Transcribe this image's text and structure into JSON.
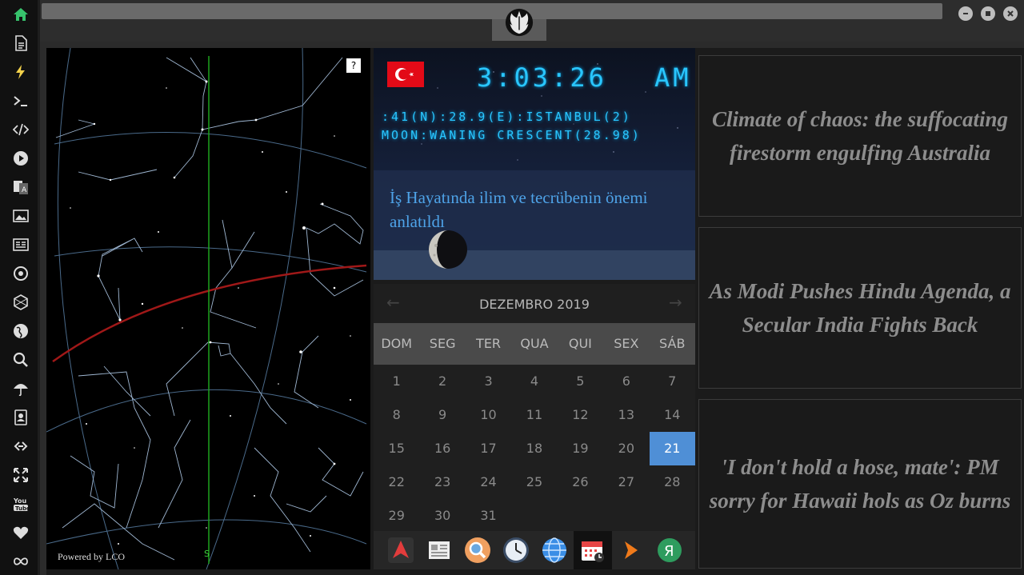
{
  "sidebar": {
    "icons": [
      "home-icon",
      "file-icon",
      "bolt-icon",
      "terminal-icon",
      "code-icon",
      "play-icon",
      "translate-icon",
      "image-icon",
      "news-icon",
      "rebel-icon",
      "hexagon-icon",
      "globe-icon",
      "search-icon",
      "umbrella-icon",
      "contacts-icon",
      "link-icon",
      "expand-icon",
      "youtube-icon",
      "heart-icon",
      "infinity-icon"
    ],
    "accent": "#37c26c"
  },
  "skymap": {
    "credit": "Powered by LCO",
    "help": "?",
    "south_marker": "S"
  },
  "clock": {
    "time": "3:03:26",
    "ampm": "AM",
    "location": ":41(N):28.9(E):ISTANBUL(2)",
    "moon": "MOON:WANING CRESCENT(28.98)",
    "headline": "İş Hayatında ilim ve tecrübenin önemi anlatıldı",
    "flag": "turkey-flag",
    "lcd_color": "#29c6ff"
  },
  "calendar": {
    "prev": "←",
    "next": "→",
    "month": "DEZEMBRO 2019",
    "dow": [
      "DOM",
      "SEG",
      "TER",
      "QUA",
      "QUI",
      "SEX",
      "SÁB"
    ],
    "weeks": [
      [
        "1",
        "2",
        "3",
        "4",
        "5",
        "6",
        "7"
      ],
      [
        "8",
        "9",
        "10",
        "11",
        "12",
        "13",
        "14"
      ],
      [
        "15",
        "16",
        "17",
        "18",
        "19",
        "20",
        "21"
      ],
      [
        "22",
        "23",
        "24",
        "25",
        "26",
        "27",
        "28"
      ],
      [
        "29",
        "30",
        "31",
        "",
        "",
        "",
        ""
      ]
    ],
    "today": "21",
    "highlight_color": "#4f8fd6"
  },
  "dock": {
    "apps": [
      "arch-icon",
      "newspaper-icon",
      "magnifier-icon",
      "clock-icon",
      "globe-icon",
      "calendar-icon",
      "arrow-icon",
      "yandex-icon"
    ],
    "active": "calendar-icon"
  },
  "news": [
    "Climate of chaos: the suffocating firestorm engulfing Australia",
    "As Modi Pushes Hindu Agenda, a Secular India Fights Back",
    "'I don't hold a hose, mate': PM sorry for Hawaii hols as Oz burns"
  ]
}
